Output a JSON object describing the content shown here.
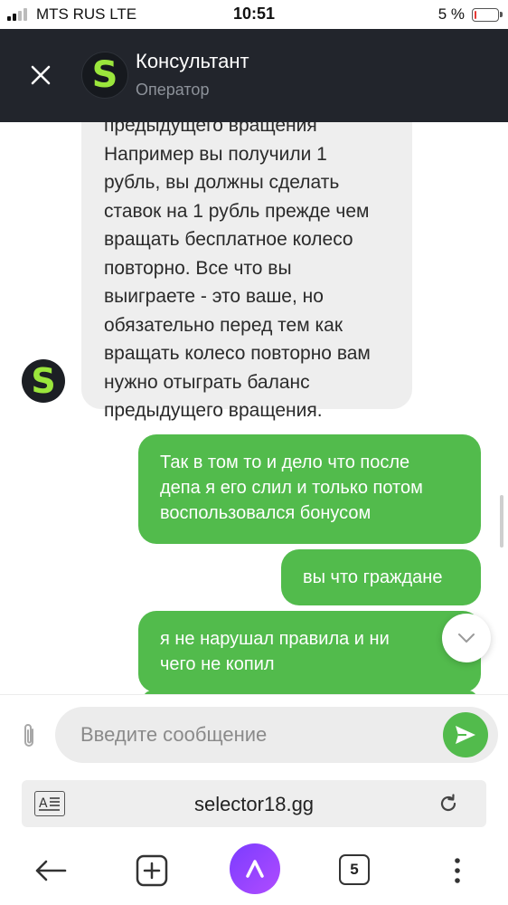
{
  "status_bar": {
    "carrier": "MTS RUS  LTE",
    "time": "10:51",
    "battery": "5 %",
    "battery_level_fraction": 0.05
  },
  "header": {
    "avatar_letter": "S",
    "title": "Консультант",
    "subtitle": "Оператор"
  },
  "chat": {
    "incoming_avatar_letter": "S",
    "incoming_lines": [
      "предыдущего вращения",
      "Например вы получили 1",
      "рубль, вы должны сделать",
      "ставок на 1 рубль прежде чем",
      "вращать бесплатное колесо",
      "повторно. Все что вы",
      "выиграете - это ваше, но",
      "обязательно перед тем как",
      "вращать колесо повторно вам",
      "нужно отыграть баланс",
      "предыдущего вращения."
    ],
    "outgoing": [
      {
        "lines": [
          "Так в том то и дело что после",
          "депа я его слил и только потом",
          "воспользовался бонусом"
        ]
      },
      {
        "lines": [
          "вы что граждане"
        ]
      },
      {
        "lines": [
          "я не нарушал правила и ни",
          "чего не копил"
        ]
      }
    ]
  },
  "composer": {
    "placeholder": "Введите сообщение"
  },
  "browser": {
    "url": "selector18.gg",
    "tabs_count": "5"
  },
  "colors": {
    "header_bg": "#22252c",
    "accent_green": "#52bb4c",
    "logo_green": "#9be63c",
    "incoming_bubble": "#eeeeee",
    "alice_purple": "#8a3dff"
  }
}
